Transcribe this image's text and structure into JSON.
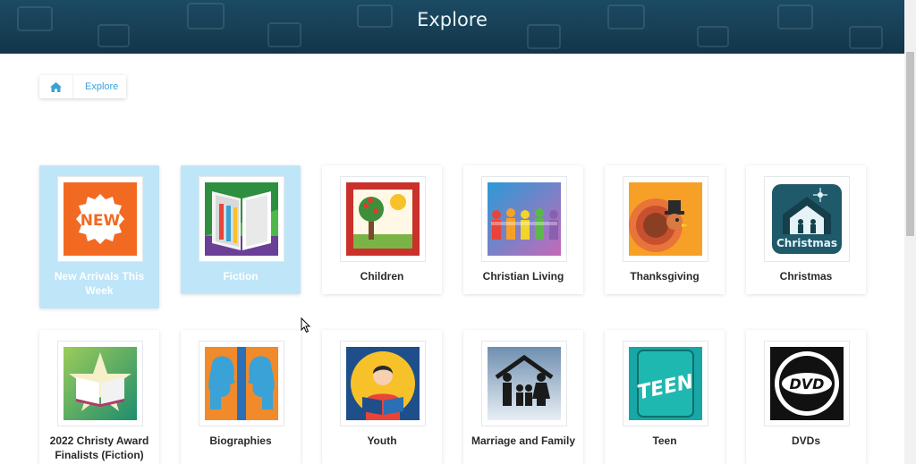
{
  "header": {
    "title": "Explore"
  },
  "breadcrumb": {
    "home_icon": "home-icon",
    "current": "Explore"
  },
  "colors": {
    "header_bg": "#173f55",
    "accent": "#3aa2d6",
    "highlight": "#bfe5f8"
  },
  "categories": [
    {
      "label": "New Arrivals This Week",
      "icon": "new-badge-icon"
    },
    {
      "label": "Fiction",
      "icon": "open-book-icon"
    },
    {
      "label": "Children",
      "icon": "tree-sun-icon"
    },
    {
      "label": "Christian Living",
      "icon": "people-chain-icon"
    },
    {
      "label": "Thanksgiving",
      "icon": "turkey-icon"
    },
    {
      "label": "Christmas",
      "icon": "nativity-icon",
      "image_text": "Christmas"
    },
    {
      "label": "2022 Christy Award Finalists (Fiction)",
      "icon": "star-book-icon"
    },
    {
      "label": "Biographies",
      "icon": "profiles-icon"
    },
    {
      "label": "Youth",
      "icon": "reader-icon"
    },
    {
      "label": "Marriage and Family",
      "icon": "family-house-icon"
    },
    {
      "label": "Teen",
      "icon": "teen-icon",
      "image_text": "TEEN"
    },
    {
      "label": "DVDs",
      "icon": "dvd-icon",
      "image_text": "DVD"
    }
  ]
}
